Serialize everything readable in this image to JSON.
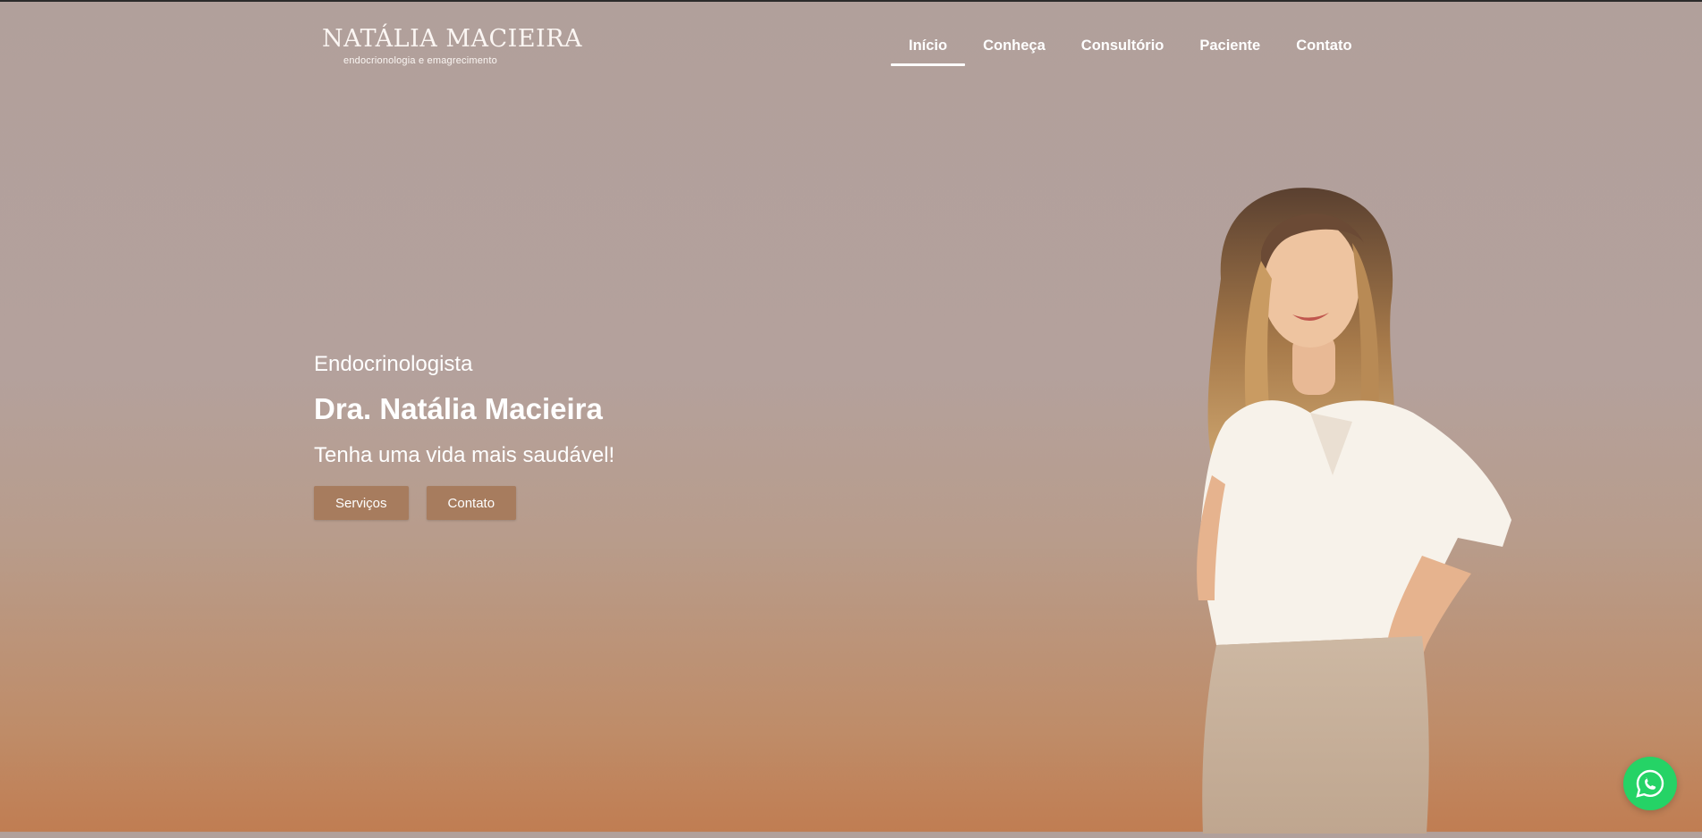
{
  "logo": {
    "name": "NATÁLIA MACIEIRA",
    "tagline": "endocrionologia e emagrecimento"
  },
  "nav": {
    "items": [
      {
        "label": "Início",
        "active": true
      },
      {
        "label": "Conheça"
      },
      {
        "label": "Consultório"
      },
      {
        "label": "Paciente"
      },
      {
        "label": "Contato"
      }
    ]
  },
  "hero": {
    "eyebrow": "Endocrinologista",
    "title": "Dra. Natália Macieira",
    "subtitle": "Tenha uma vida mais saudável!",
    "buttons": {
      "services": "Serviços",
      "contact": "Contato"
    }
  },
  "floating": {
    "icon": "whatsapp-icon"
  },
  "colors": {
    "button": "#a77c5e",
    "whatsapp": "#25d366",
    "text": "#ffffff"
  }
}
